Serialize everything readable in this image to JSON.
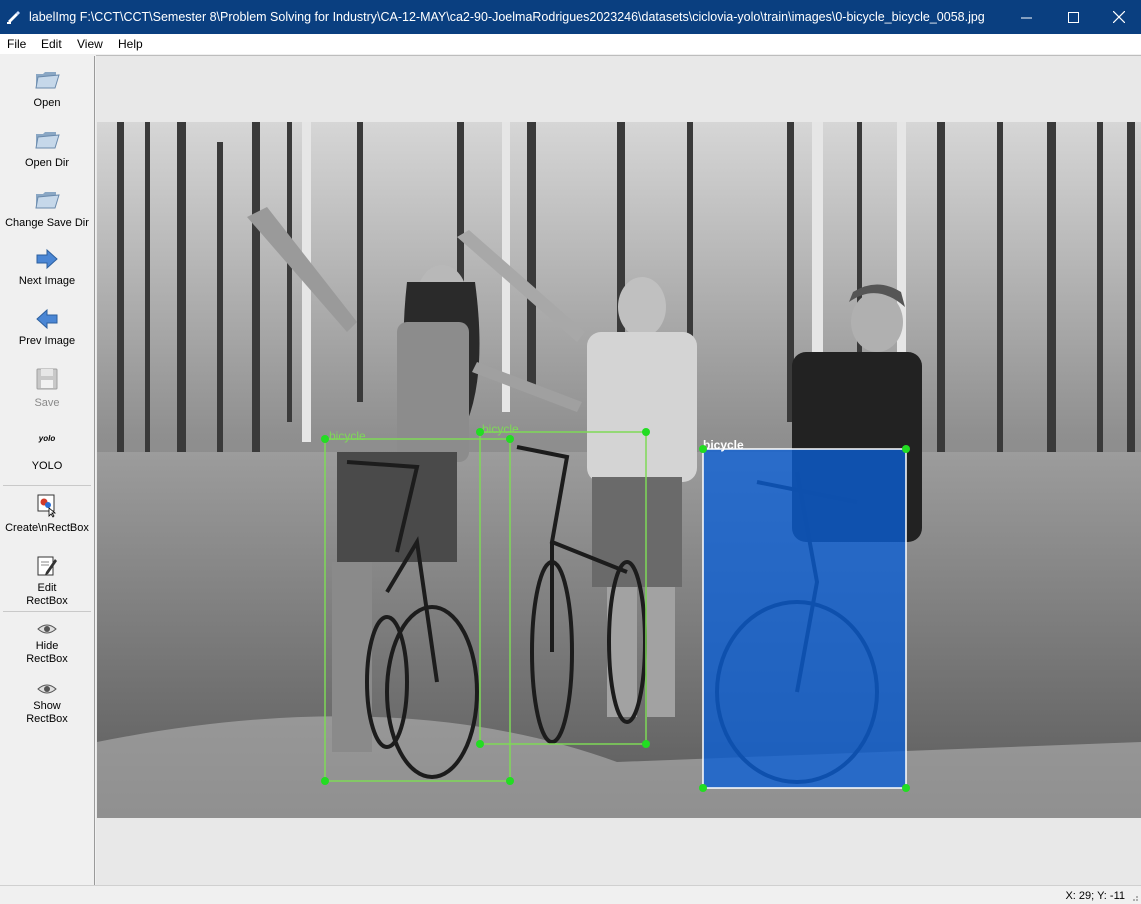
{
  "window": {
    "title": "labelImg F:\\CCT\\CCT\\Semester 8\\Problem Solving for Industry\\CA-12-MAY\\ca2-90-JoelmaRodrigues2023246\\datasets\\ciclovia-yolo\\train\\images\\0-bicycle_bicycle_0058.jpg",
    "title_bar_color": "#0a3f80"
  },
  "menu": {
    "items": [
      "File",
      "Edit",
      "View",
      "Help"
    ]
  },
  "toolbar": {
    "open": "Open",
    "open_dir": "Open Dir",
    "change_save_dir": "Change Save Dir",
    "next_image": "Next Image",
    "prev_image": "Prev Image",
    "save": "Save",
    "yolo_icon_text": "yolo",
    "yolo": "YOLO",
    "create_rectbox": "Create\\nRectBox",
    "edit_rectbox_1": "Edit",
    "edit_rectbox_2": "RectBox",
    "hide_rectbox_1": "Hide",
    "hide_rectbox_2": "RectBox",
    "show_rectbox_1": "Show",
    "show_rectbox_2": "RectBox"
  },
  "annotations": {
    "labels": [
      "bicycle",
      "bicycle",
      "bicycle"
    ],
    "box_color": "#7ed957",
    "selected_fill": "#0a5fd6",
    "handle_color": "#22dd22"
  },
  "status": {
    "coords": "X: 29; Y: -11"
  }
}
